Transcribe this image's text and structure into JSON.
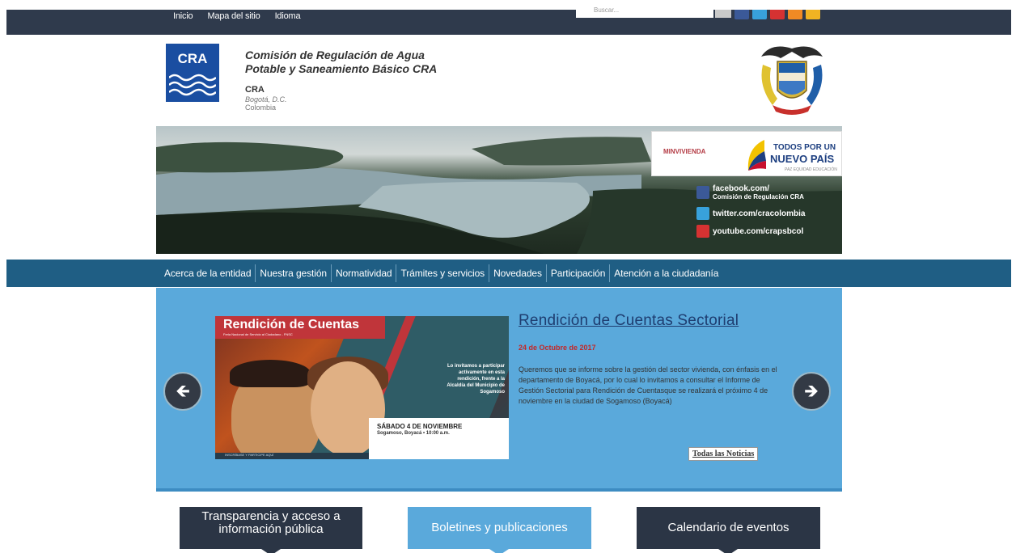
{
  "topbar": {
    "links": [
      "Inicio",
      "Mapa del sitio",
      "Idioma"
    ],
    "search_placeholder": "Buscar...",
    "social": [
      {
        "icon": "facebook-icon",
        "color": "#3b5998"
      },
      {
        "icon": "twitter-icon",
        "color": "#38a1db"
      },
      {
        "icon": "youtube-icon",
        "color": "#d63232"
      },
      {
        "icon": "rss-icon",
        "color": "#f08a24"
      },
      {
        "icon": "email-icon",
        "color": "#f0b323"
      }
    ]
  },
  "header": {
    "logo_text": "CRA",
    "title_line1": "Comisión de Regulación de Agua",
    "title_line2": "Potable y Saneamiento Básico CRA",
    "abbr": "CRA",
    "city": "Bogotá, D.C.",
    "country": "Colombia"
  },
  "banner": {
    "ministry": "MINVIVIENDA",
    "slogan_line1": "TODOS POR UN",
    "slogan_line2": "NUEVO PAÍS",
    "slogan_sub": "PAZ  EQUIDAD  EDUCACIÓN",
    "facebook": "facebook.com/",
    "facebook_sub": "Comisión de Regulación CRA",
    "twitter": "twitter.com/cracolombia",
    "youtube": "youtube.com/crapsbcol"
  },
  "mainnav": {
    "items": [
      "Acerca de la entidad",
      "Nuestra gestión",
      "Normatividad",
      "Trámites y servicios",
      "Novedades",
      "Participación",
      "Atención a la ciudadanía"
    ]
  },
  "slider": {
    "promo_title": "Rendición de Cuentas",
    "promo_subtitle": "Feria Nacional de Servicio al Ciudadano - FNSC",
    "promo_invite": "Lo invitamos a participar activamente en esta rendición, frente a la Alcaldía del Municipio de Sogamoso",
    "promo_date": "SÁBADO 4 DE NOVIEMBRE",
    "promo_place": "Sogamoso, Boyacá • 10:00 a.m.",
    "promo_footer": "INSCRÍBASE Y PARTICIPE AQUÍ",
    "news_title": "Rendición de Cuentas Sectorial",
    "news_date": "24 de Octubre de 2017",
    "news_body": "Queremos que se informe sobre la gestión del sector vivienda, con énfasis en el departamento de Boyacá, por lo cual lo invitamos a consultar el Informe de Gestión Sectorial para Rendición de Cuentasque se realizará el próximo 4 de noviembre en la ciudad de Sogamoso (Boyacá)",
    "all_news": "Todas las Noticias",
    "prev_icon": "arrow-left-icon",
    "next_icon": "arrow-right-icon"
  },
  "tiles": {
    "transparency_line1": "Transparencia y acceso a",
    "transparency_line2": "información pública",
    "bulletins": "Boletines y publicaciones",
    "calendar": "Calendario de eventos"
  }
}
